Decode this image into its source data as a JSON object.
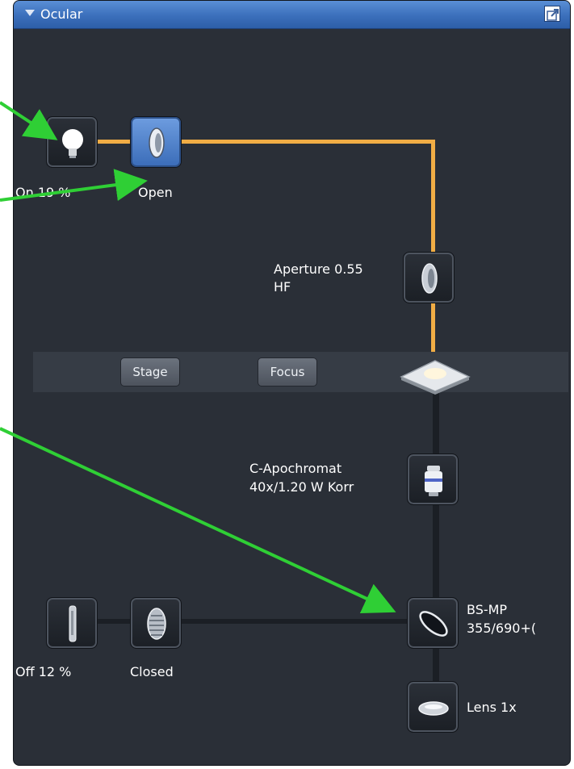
{
  "panel": {
    "title": "Ocular"
  },
  "light_source_top": {
    "label": "On 19 %"
  },
  "shutter_top": {
    "label": "Open"
  },
  "aperture": {
    "label_line1": "Aperture 0.55",
    "label_line2": "HF"
  },
  "stage_bar": {
    "stage_label": "Stage",
    "focus_label": "Focus"
  },
  "objective": {
    "label_line1": "C-Apochromat",
    "label_line2": "40x/1.20 W Korr"
  },
  "beam_splitter": {
    "label_line1": "BS-MP",
    "label_line2": "355/690+("
  },
  "lens": {
    "label": "Lens 1x"
  },
  "light_source_bottom": {
    "label": "Off 12 %"
  },
  "shutter_bottom": {
    "label": "Closed"
  },
  "colors": {
    "light_path": "#f1ad45",
    "arrow": "#2fcf35",
    "title_bar": "#3b6fbb"
  },
  "icons": [
    "chevron-down-icon",
    "undock-icon",
    "bulb-icon",
    "shutter-icon",
    "aperture-lens-icon",
    "mirror-icon",
    "objective-icon",
    "beam-splitter-icon",
    "lens-icon",
    "halogen-lamp-icon",
    "closed-shutter-icon"
  ]
}
